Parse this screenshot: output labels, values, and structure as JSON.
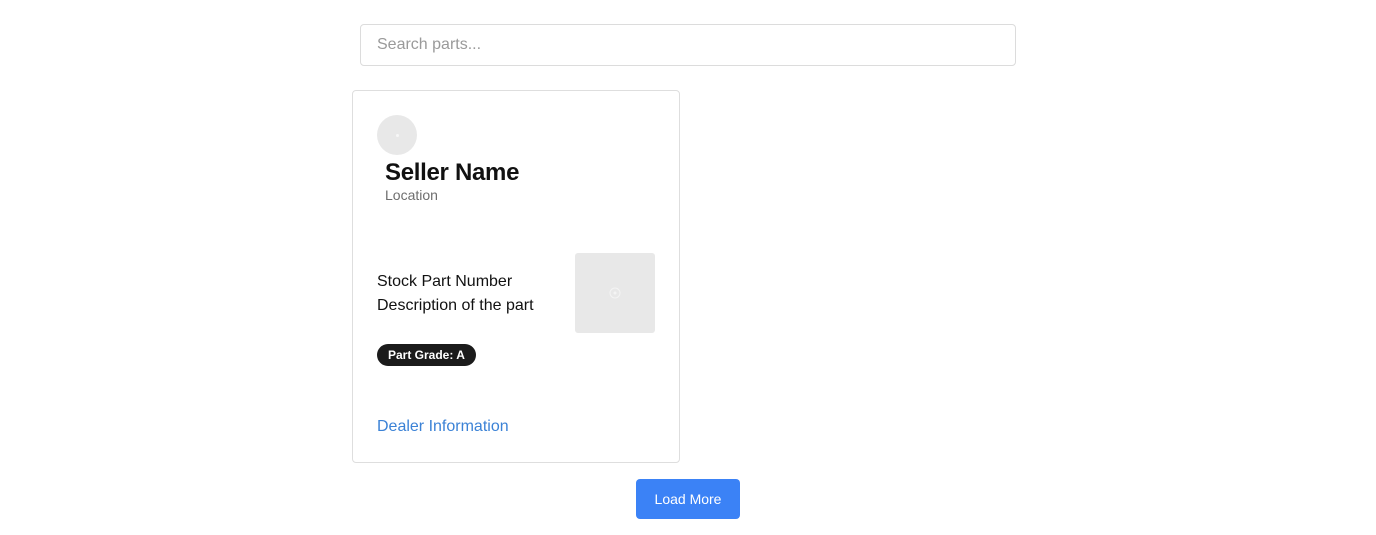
{
  "search": {
    "placeholder": "Search parts...",
    "value": ""
  },
  "listing": {
    "seller_name": "Seller Name",
    "seller_location": "Location",
    "part_number": "Stock Part Number",
    "part_description": "Description of the part",
    "grade_badge": "Part Grade: A",
    "dealer_link": "Dealer Information",
    "avatar_icon": "avatar-placeholder-icon",
    "image_icon": "image-placeholder-icon"
  },
  "actions": {
    "load_more_label": "Load More"
  },
  "colors": {
    "accent": "#3b82f6",
    "link": "#3b82d6",
    "badge_bg": "#1b1b1b"
  }
}
